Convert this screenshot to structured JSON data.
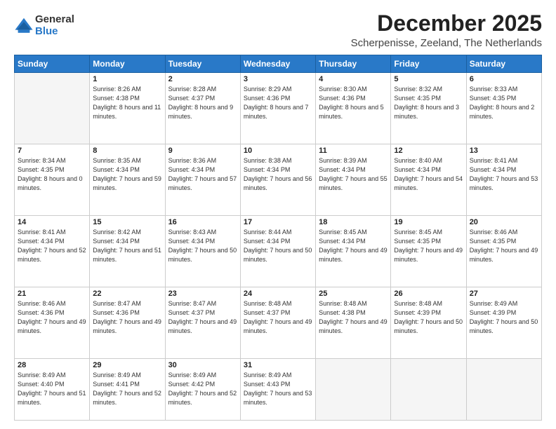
{
  "logo": {
    "general": "General",
    "blue": "Blue"
  },
  "title": "December 2025",
  "location": "Scherpenisse, Zeeland, The Netherlands",
  "days_of_week": [
    "Sunday",
    "Monday",
    "Tuesday",
    "Wednesday",
    "Thursday",
    "Friday",
    "Saturday"
  ],
  "weeks": [
    [
      {
        "num": "",
        "sunrise": "",
        "sunset": "",
        "daylight": "",
        "empty": true
      },
      {
        "num": "1",
        "sunrise": "Sunrise: 8:26 AM",
        "sunset": "Sunset: 4:38 PM",
        "daylight": "Daylight: 8 hours and 11 minutes.",
        "empty": false
      },
      {
        "num": "2",
        "sunrise": "Sunrise: 8:28 AM",
        "sunset": "Sunset: 4:37 PM",
        "daylight": "Daylight: 8 hours and 9 minutes.",
        "empty": false
      },
      {
        "num": "3",
        "sunrise": "Sunrise: 8:29 AM",
        "sunset": "Sunset: 4:36 PM",
        "daylight": "Daylight: 8 hours and 7 minutes.",
        "empty": false
      },
      {
        "num": "4",
        "sunrise": "Sunrise: 8:30 AM",
        "sunset": "Sunset: 4:36 PM",
        "daylight": "Daylight: 8 hours and 5 minutes.",
        "empty": false
      },
      {
        "num": "5",
        "sunrise": "Sunrise: 8:32 AM",
        "sunset": "Sunset: 4:35 PM",
        "daylight": "Daylight: 8 hours and 3 minutes.",
        "empty": false
      },
      {
        "num": "6",
        "sunrise": "Sunrise: 8:33 AM",
        "sunset": "Sunset: 4:35 PM",
        "daylight": "Daylight: 8 hours and 2 minutes.",
        "empty": false
      }
    ],
    [
      {
        "num": "7",
        "sunrise": "Sunrise: 8:34 AM",
        "sunset": "Sunset: 4:35 PM",
        "daylight": "Daylight: 8 hours and 0 minutes.",
        "empty": false
      },
      {
        "num": "8",
        "sunrise": "Sunrise: 8:35 AM",
        "sunset": "Sunset: 4:34 PM",
        "daylight": "Daylight: 7 hours and 59 minutes.",
        "empty": false
      },
      {
        "num": "9",
        "sunrise": "Sunrise: 8:36 AM",
        "sunset": "Sunset: 4:34 PM",
        "daylight": "Daylight: 7 hours and 57 minutes.",
        "empty": false
      },
      {
        "num": "10",
        "sunrise": "Sunrise: 8:38 AM",
        "sunset": "Sunset: 4:34 PM",
        "daylight": "Daylight: 7 hours and 56 minutes.",
        "empty": false
      },
      {
        "num": "11",
        "sunrise": "Sunrise: 8:39 AM",
        "sunset": "Sunset: 4:34 PM",
        "daylight": "Daylight: 7 hours and 55 minutes.",
        "empty": false
      },
      {
        "num": "12",
        "sunrise": "Sunrise: 8:40 AM",
        "sunset": "Sunset: 4:34 PM",
        "daylight": "Daylight: 7 hours and 54 minutes.",
        "empty": false
      },
      {
        "num": "13",
        "sunrise": "Sunrise: 8:41 AM",
        "sunset": "Sunset: 4:34 PM",
        "daylight": "Daylight: 7 hours and 53 minutes.",
        "empty": false
      }
    ],
    [
      {
        "num": "14",
        "sunrise": "Sunrise: 8:41 AM",
        "sunset": "Sunset: 4:34 PM",
        "daylight": "Daylight: 7 hours and 52 minutes.",
        "empty": false
      },
      {
        "num": "15",
        "sunrise": "Sunrise: 8:42 AM",
        "sunset": "Sunset: 4:34 PM",
        "daylight": "Daylight: 7 hours and 51 minutes.",
        "empty": false
      },
      {
        "num": "16",
        "sunrise": "Sunrise: 8:43 AM",
        "sunset": "Sunset: 4:34 PM",
        "daylight": "Daylight: 7 hours and 50 minutes.",
        "empty": false
      },
      {
        "num": "17",
        "sunrise": "Sunrise: 8:44 AM",
        "sunset": "Sunset: 4:34 PM",
        "daylight": "Daylight: 7 hours and 50 minutes.",
        "empty": false
      },
      {
        "num": "18",
        "sunrise": "Sunrise: 8:45 AM",
        "sunset": "Sunset: 4:34 PM",
        "daylight": "Daylight: 7 hours and 49 minutes.",
        "empty": false
      },
      {
        "num": "19",
        "sunrise": "Sunrise: 8:45 AM",
        "sunset": "Sunset: 4:35 PM",
        "daylight": "Daylight: 7 hours and 49 minutes.",
        "empty": false
      },
      {
        "num": "20",
        "sunrise": "Sunrise: 8:46 AM",
        "sunset": "Sunset: 4:35 PM",
        "daylight": "Daylight: 7 hours and 49 minutes.",
        "empty": false
      }
    ],
    [
      {
        "num": "21",
        "sunrise": "Sunrise: 8:46 AM",
        "sunset": "Sunset: 4:36 PM",
        "daylight": "Daylight: 7 hours and 49 minutes.",
        "empty": false
      },
      {
        "num": "22",
        "sunrise": "Sunrise: 8:47 AM",
        "sunset": "Sunset: 4:36 PM",
        "daylight": "Daylight: 7 hours and 49 minutes.",
        "empty": false
      },
      {
        "num": "23",
        "sunrise": "Sunrise: 8:47 AM",
        "sunset": "Sunset: 4:37 PM",
        "daylight": "Daylight: 7 hours and 49 minutes.",
        "empty": false
      },
      {
        "num": "24",
        "sunrise": "Sunrise: 8:48 AM",
        "sunset": "Sunset: 4:37 PM",
        "daylight": "Daylight: 7 hours and 49 minutes.",
        "empty": false
      },
      {
        "num": "25",
        "sunrise": "Sunrise: 8:48 AM",
        "sunset": "Sunset: 4:38 PM",
        "daylight": "Daylight: 7 hours and 49 minutes.",
        "empty": false
      },
      {
        "num": "26",
        "sunrise": "Sunrise: 8:48 AM",
        "sunset": "Sunset: 4:39 PM",
        "daylight": "Daylight: 7 hours and 50 minutes.",
        "empty": false
      },
      {
        "num": "27",
        "sunrise": "Sunrise: 8:49 AM",
        "sunset": "Sunset: 4:39 PM",
        "daylight": "Daylight: 7 hours and 50 minutes.",
        "empty": false
      }
    ],
    [
      {
        "num": "28",
        "sunrise": "Sunrise: 8:49 AM",
        "sunset": "Sunset: 4:40 PM",
        "daylight": "Daylight: 7 hours and 51 minutes.",
        "empty": false
      },
      {
        "num": "29",
        "sunrise": "Sunrise: 8:49 AM",
        "sunset": "Sunset: 4:41 PM",
        "daylight": "Daylight: 7 hours and 52 minutes.",
        "empty": false
      },
      {
        "num": "30",
        "sunrise": "Sunrise: 8:49 AM",
        "sunset": "Sunset: 4:42 PM",
        "daylight": "Daylight: 7 hours and 52 minutes.",
        "empty": false
      },
      {
        "num": "31",
        "sunrise": "Sunrise: 8:49 AM",
        "sunset": "Sunset: 4:43 PM",
        "daylight": "Daylight: 7 hours and 53 minutes.",
        "empty": false
      },
      {
        "num": "",
        "sunrise": "",
        "sunset": "",
        "daylight": "",
        "empty": true
      },
      {
        "num": "",
        "sunrise": "",
        "sunset": "",
        "daylight": "",
        "empty": true
      },
      {
        "num": "",
        "sunrise": "",
        "sunset": "",
        "daylight": "",
        "empty": true
      }
    ]
  ]
}
